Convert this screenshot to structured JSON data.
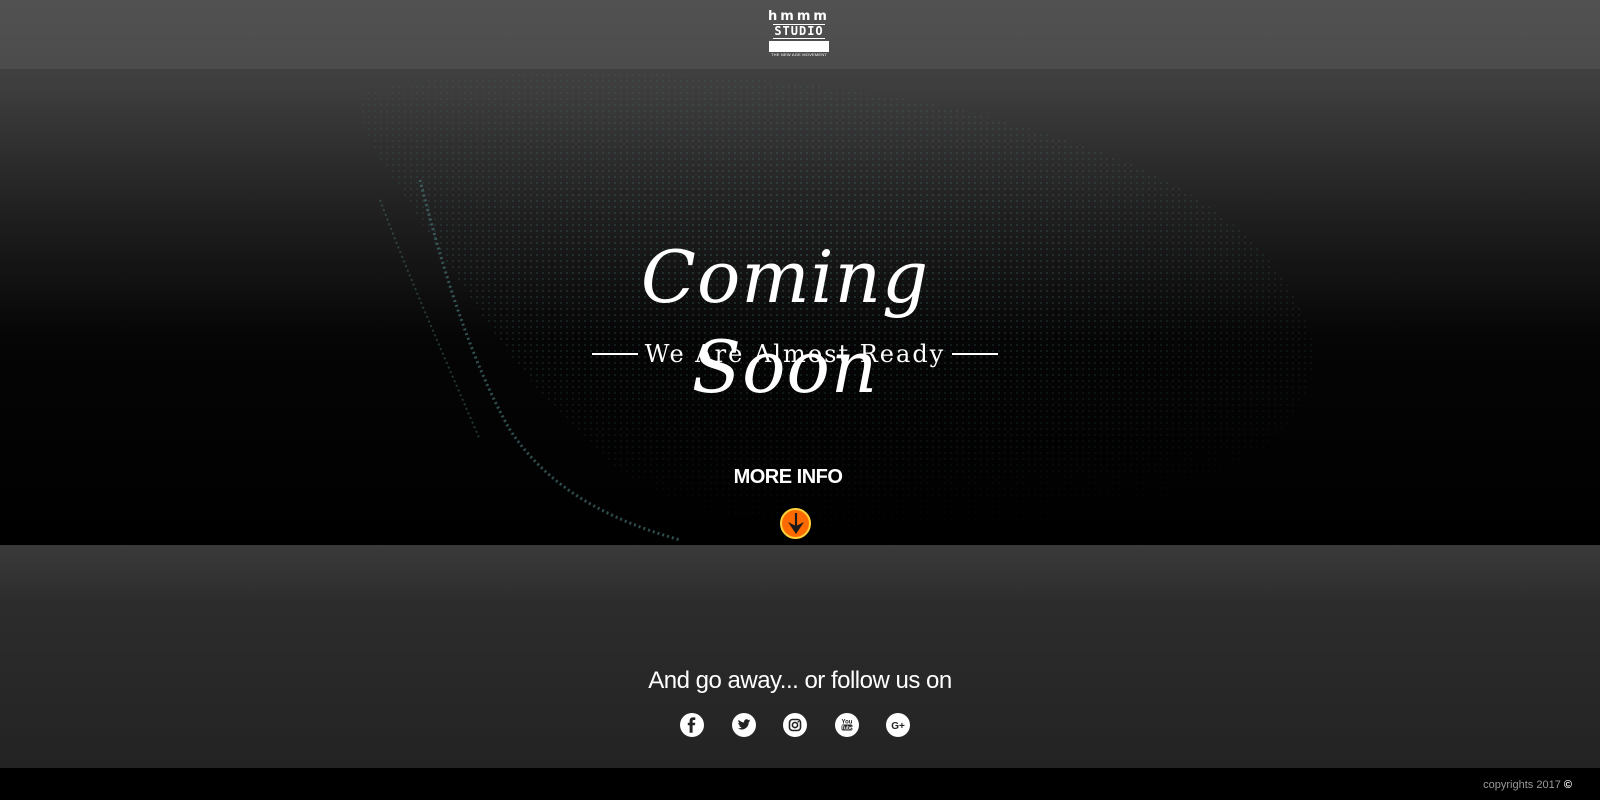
{
  "header": {
    "logo_line1": "hmmm",
    "logo_line2": "STUDIO",
    "logo_tagline": "THE NEW AGE MOVEMENT"
  },
  "hero": {
    "title": "Coming Soon",
    "subtitle": "We Are Almost Ready",
    "more_info_label": "MORE INFO",
    "arrow_icon": "arrow-down-icon",
    "arrow_color": "#ff6a00"
  },
  "social": {
    "follow_text": "And go away... or follow us on",
    "icons": [
      {
        "name": "facebook-icon",
        "glyph": "f"
      },
      {
        "name": "twitter-icon",
        "glyph": "t"
      },
      {
        "name": "instagram-icon",
        "glyph": "ig"
      },
      {
        "name": "youtube-icon",
        "glyph": "You Tube"
      },
      {
        "name": "google-plus-icon",
        "glyph": "G+"
      }
    ]
  },
  "footer": {
    "copyright_text": "copyrights 2017",
    "copyright_symbol": "©"
  }
}
